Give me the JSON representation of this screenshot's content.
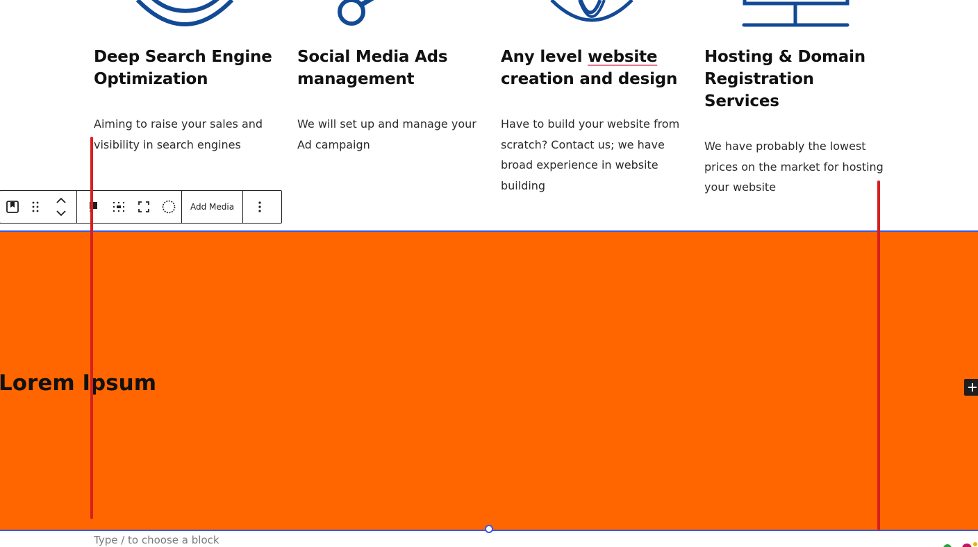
{
  "services": [
    {
      "icon": "search-engine-icon",
      "title_lines": [
        "Deep Search Engine",
        "Optimization"
      ],
      "description": "Aiming to raise your sales and visibility in search engines"
    },
    {
      "icon": "magnifier-icon",
      "title_lines": [
        "Social Media Ads",
        "management"
      ],
      "description": "We will set up and manage your Ad campaign"
    },
    {
      "icon": "globe-icon",
      "title_lines": [
        "Any level ",
        "website",
        "creation and design"
      ],
      "description": "Have to build your website from scratch? Contact us; we have broad experience in website building"
    },
    {
      "icon": "monitor-icon",
      "title_lines": [
        "Hosting & Domain",
        "Registration Services"
      ],
      "description": "We have probably the lowest prices on the market for hosting your website"
    }
  ],
  "toolbar": {
    "buttons": [
      "cover-block-icon",
      "drag-handle-icon",
      "move-up-down-icon",
      "content-position-icon",
      "align-dots-icon",
      "full-height-icon",
      "duotone-circle-icon"
    ],
    "add_media_label": "Add Media",
    "options_icon": "more-vertical-icon"
  },
  "cover": {
    "heading": "Lorem Ipsum",
    "background_color": "#ff6600",
    "selection_color": "#3858e9"
  },
  "placeholder": "Type / to choose a block",
  "colors": {
    "icon_blue": "#134a96",
    "annotation_red": "#d62020",
    "spellcheck_pink": "#e2788e"
  }
}
